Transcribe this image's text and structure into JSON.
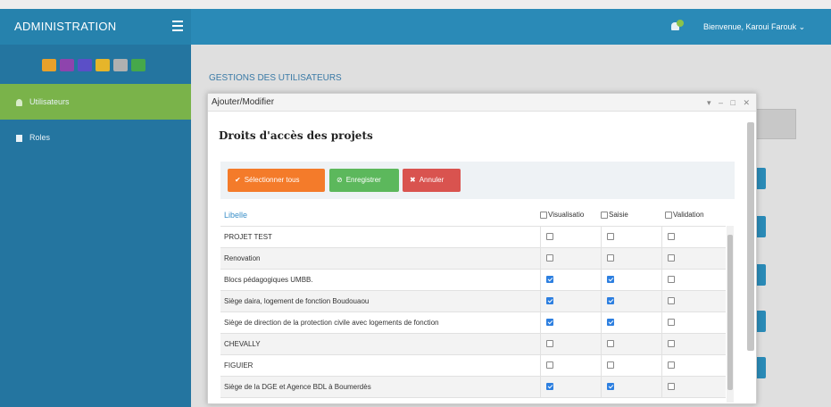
{
  "topbar": {
    "brand": "ADMINISTRATION",
    "user_label": "Bienvenue, Karoui Farouk",
    "user_caret": "⌄",
    "accent": "#2a8ab7"
  },
  "sidebar": {
    "logo_colors": [
      "#e8a12b",
      "#8e44ad",
      "#5b4fc7",
      "#e6b52a",
      "#b0b0b0",
      "#46a84a"
    ],
    "items": [
      {
        "label": "Utilisateurs",
        "icon": "user-icon",
        "active": true
      },
      {
        "label": "Roles",
        "icon": "list-icon",
        "active": false
      }
    ]
  },
  "main": {
    "title": "GESTIONS DES UTILISATEURS"
  },
  "modal": {
    "title": "Ajouter/Modifier",
    "controls": "▾ – □ ✕",
    "section_title": "Droits d'accès des projets",
    "buttons": {
      "select_all": "Sélectionner tous",
      "select_all_icon": "✔",
      "save": "Enregistrer",
      "save_icon": "⊘",
      "cancel": "Annuler",
      "cancel_icon": "✖"
    },
    "table": {
      "header_label": "Libelle",
      "col_visualisation": "Visualisatio",
      "col_saisie": "Saisie",
      "col_validation": "Validation",
      "rows": [
        {
          "label": "PROJET TEST",
          "visualisation": false,
          "saisie": false,
          "validation": false
        },
        {
          "label": "Renovation",
          "visualisation": false,
          "saisie": false,
          "validation": false
        },
        {
          "label": "Blocs pédagogiques UMBB.",
          "visualisation": true,
          "saisie": true,
          "validation": false
        },
        {
          "label": "Siège daira, logement de fonction Boudouaou",
          "visualisation": true,
          "saisie": true,
          "validation": false
        },
        {
          "label": "Siège de direction de la protection civile avec logements de fonction",
          "visualisation": true,
          "saisie": true,
          "validation": false
        },
        {
          "label": "CHEVALLY",
          "visualisation": false,
          "saisie": false,
          "validation": false
        },
        {
          "label": "FIGUIER",
          "visualisation": false,
          "saisie": false,
          "validation": false
        },
        {
          "label": "Siège de la DGE et Agence BDL à Boumerdès",
          "visualisation": true,
          "saisie": true,
          "validation": false
        }
      ]
    }
  }
}
